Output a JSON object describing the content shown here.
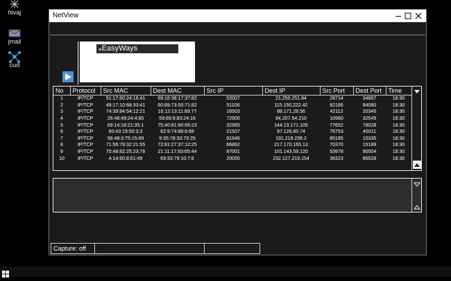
{
  "desktop": {
    "icons": [
      {
        "label": "hivaj",
        "icon": "sparkle-icon"
      },
      {
        "label": "jmail",
        "icon": "mail-icon"
      },
      {
        "label": "cud",
        "icon": "network-icon"
      }
    ]
  },
  "window": {
    "title": "NetView",
    "controls": [
      "minimize-icon",
      "maximize-icon",
      "close-icon"
    ]
  },
  "toolbar": {
    "start_icon": "play-icon",
    "logo_text": "EasyWays"
  },
  "table": {
    "columns": [
      "No",
      "Protocol",
      "Src MAC",
      "Dest MAC",
      "Src IP",
      "Dest IP",
      "Src Port",
      "Dest Port",
      "Time"
    ],
    "rows": [
      [
        "1",
        "IP/TCP",
        "51:17:60:24:16:41",
        "69:18:38:17:37:82",
        "52007",
        "21.250.251.84",
        "28714",
        "34667",
        "18:30"
      ],
      [
        "2",
        "IP/TCP",
        "49:17:10:88:33:41",
        "60:89:73:50:71:82",
        "51106",
        "115.150.222.42",
        "82166",
        "84080",
        "18:30"
      ],
      [
        "3",
        "IP/TCP",
        "74:39:84:54:12:21",
        "16:12:13:11:89:77",
        "16503",
        "88.171.28.56",
        "42112",
        "20345",
        "18:30"
      ],
      [
        "4",
        "IP/TCP",
        "26:48:48:24:4:85",
        "59:69:9:83:24:16",
        "72900",
        "84.207.54.210",
        "10980",
        "32549",
        "18:30"
      ],
      [
        "5",
        "IP/TCP",
        "69:14:18:21:35:1",
        "75:40:81:60:66:23",
        "32965",
        "144.13.171.105",
        "77652",
        "78028",
        "18:30"
      ],
      [
        "6",
        "IP/TCP",
        "80:43:19:50:3:3",
        "82:9:74:88:6:68",
        "21507",
        "97.126.60.74",
        "76753",
        "45011",
        "18:30"
      ],
      [
        "7",
        "IP/TCP",
        "56:48:3:75:15:69",
        "9:35:78:33:79:25",
        "91946",
        "191.219.236.2",
        "85185",
        "10335",
        "18:30"
      ],
      [
        "8",
        "IP/TCP",
        "71:56:79:32:21:55",
        "72:81:27:37:12:25",
        "66862",
        "217.170.165.13",
        "70370",
        "15189",
        "18:30"
      ],
      [
        "9",
        "IP/TCP",
        "70:48:82:25:23:76",
        "21:11:17:63:65:44",
        "87001",
        "101.143.59.120",
        "53978",
        "90004",
        "18:30"
      ],
      [
        "10",
        "IP/TCP",
        "4:14:60:8:61:49",
        "69:33:79:10:7:6",
        "20055",
        "232.127.219.154",
        "36323",
        "86528",
        "18:30"
      ]
    ]
  },
  "statusbar": {
    "capture": "Capture: off",
    "field2": "",
    "field3": ""
  },
  "colors": {
    "background": "#000000",
    "window_body": "#1b1b1b",
    "titlebar": "#ffffff",
    "accent": "#4a90d9"
  }
}
